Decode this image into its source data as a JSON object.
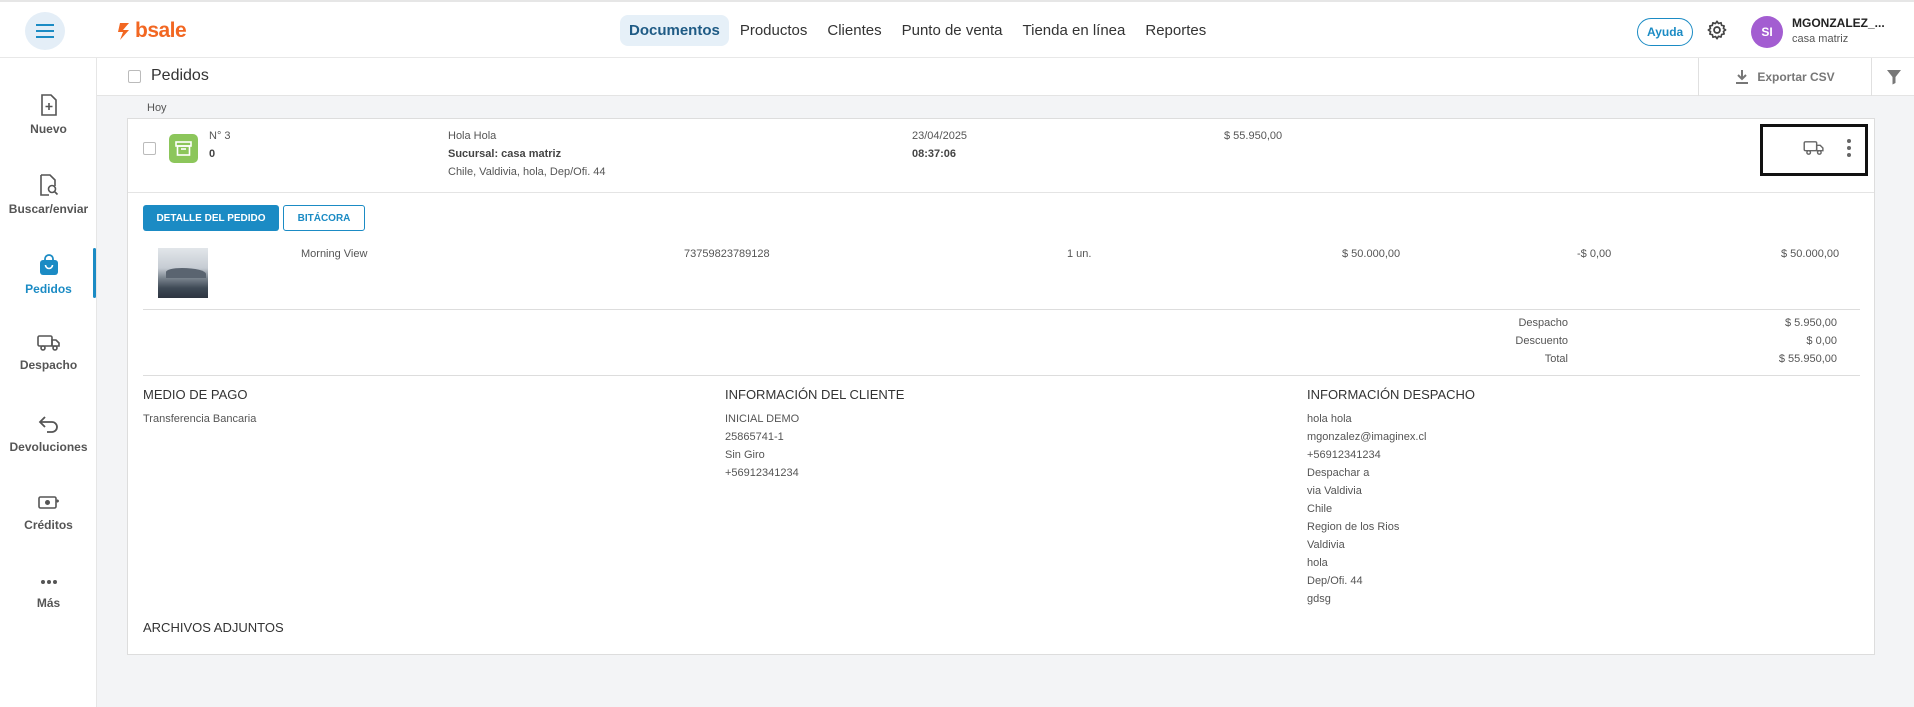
{
  "brand": {
    "name": "bsale",
    "color": "#f26722"
  },
  "nav": [
    {
      "label": "Documentos",
      "active": true
    },
    {
      "label": "Productos"
    },
    {
      "label": "Clientes"
    },
    {
      "label": "Punto de venta"
    },
    {
      "label": "Tienda en línea"
    },
    {
      "label": "Reportes"
    }
  ],
  "topbar": {
    "help_label": "Ayuda",
    "avatar_initials": "SI",
    "user_name": "MGONZALEZ_...",
    "user_branch": "casa matriz"
  },
  "sidebar": [
    {
      "label": "Nuevo",
      "icon": "new-document-icon"
    },
    {
      "label": "Buscar/enviar",
      "icon": "search-document-icon"
    },
    {
      "label": "Pedidos",
      "icon": "shopping-bag-icon",
      "active": true
    },
    {
      "label": "Despacho",
      "icon": "truck-icon"
    },
    {
      "label": "Devoluciones",
      "icon": "return-arrow-icon"
    },
    {
      "label": "Créditos",
      "icon": "money-icon"
    },
    {
      "label": "Más",
      "icon": "more-icon"
    }
  ],
  "header": {
    "title": "Pedidos",
    "export_label": "Exportar CSV"
  },
  "group_label": "Hoy",
  "order": {
    "number": "N° 3",
    "sub": "0",
    "client": "Hola Hola",
    "branch": "Sucursal: casa matriz",
    "address": "Chile, Valdivia, hola, Dep/Ofi. 44",
    "date": "23/04/2025",
    "time": "08:37:06",
    "amount": "$ 55.950,00"
  },
  "buttons": {
    "detail": "DETALLE DEL PEDIDO",
    "log": "BITÁCORA"
  },
  "item": {
    "name": "Morning View",
    "code": "73759823789128",
    "qty": "1 un.",
    "price": "$ 50.000,00",
    "discount": "-$ 0,00",
    "total": "$ 50.000,00"
  },
  "totals": [
    {
      "label": "Despacho",
      "value": "$ 5.950,00"
    },
    {
      "label": "Descuento",
      "value": "$ 0,00"
    },
    {
      "label": "Total",
      "value": "$ 55.950,00"
    }
  ],
  "payment": {
    "title": "MEDIO DE PAGO",
    "method": "Transferencia Bancaria"
  },
  "client_info": {
    "title": "INFORMACIÓN DEL CLIENTE",
    "lines": [
      "INICIAL DEMO",
      "25865741-1",
      "Sin Giro",
      "+56912341234"
    ]
  },
  "shipping_info": {
    "title": "INFORMACIÓN DESPACHO",
    "lines": [
      "hola hola",
      "mgonzalez@imaginex.cl",
      "+56912341234",
      "Despachar a",
      "via Valdivia",
      "Chile",
      "Region de los Rios",
      "Valdivia",
      "hola",
      "Dep/Ofi. 44",
      "gdsg"
    ]
  },
  "attachments": {
    "title": "ARCHIVOS ADJUNTOS"
  }
}
